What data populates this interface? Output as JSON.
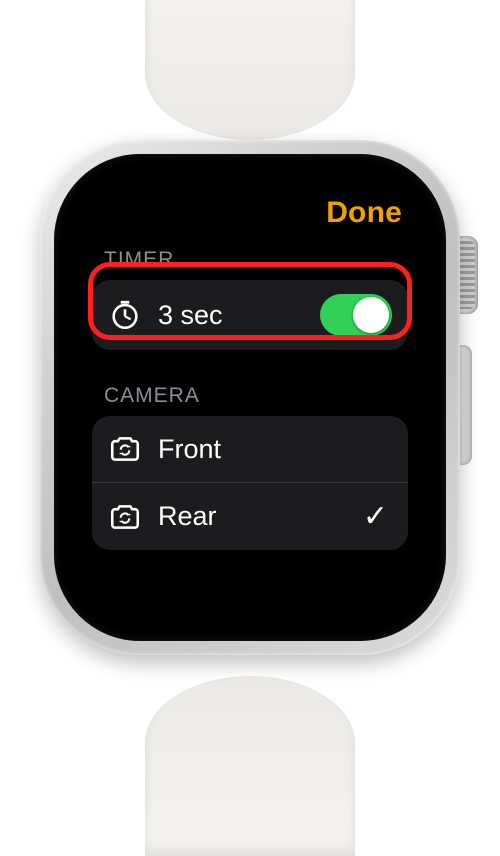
{
  "header": {
    "done_label": "Done"
  },
  "timer": {
    "section_label": "TIMER",
    "duration_label": "3 sec",
    "toggle_on": true
  },
  "camera": {
    "section_label": "CAMERA",
    "options": [
      {
        "label": "Front",
        "selected": false
      },
      {
        "label": "Rear",
        "selected": true
      }
    ]
  },
  "colors": {
    "accent": "#f2a100",
    "toggle_on": "#31d158",
    "highlight": "#ff1f1f"
  }
}
